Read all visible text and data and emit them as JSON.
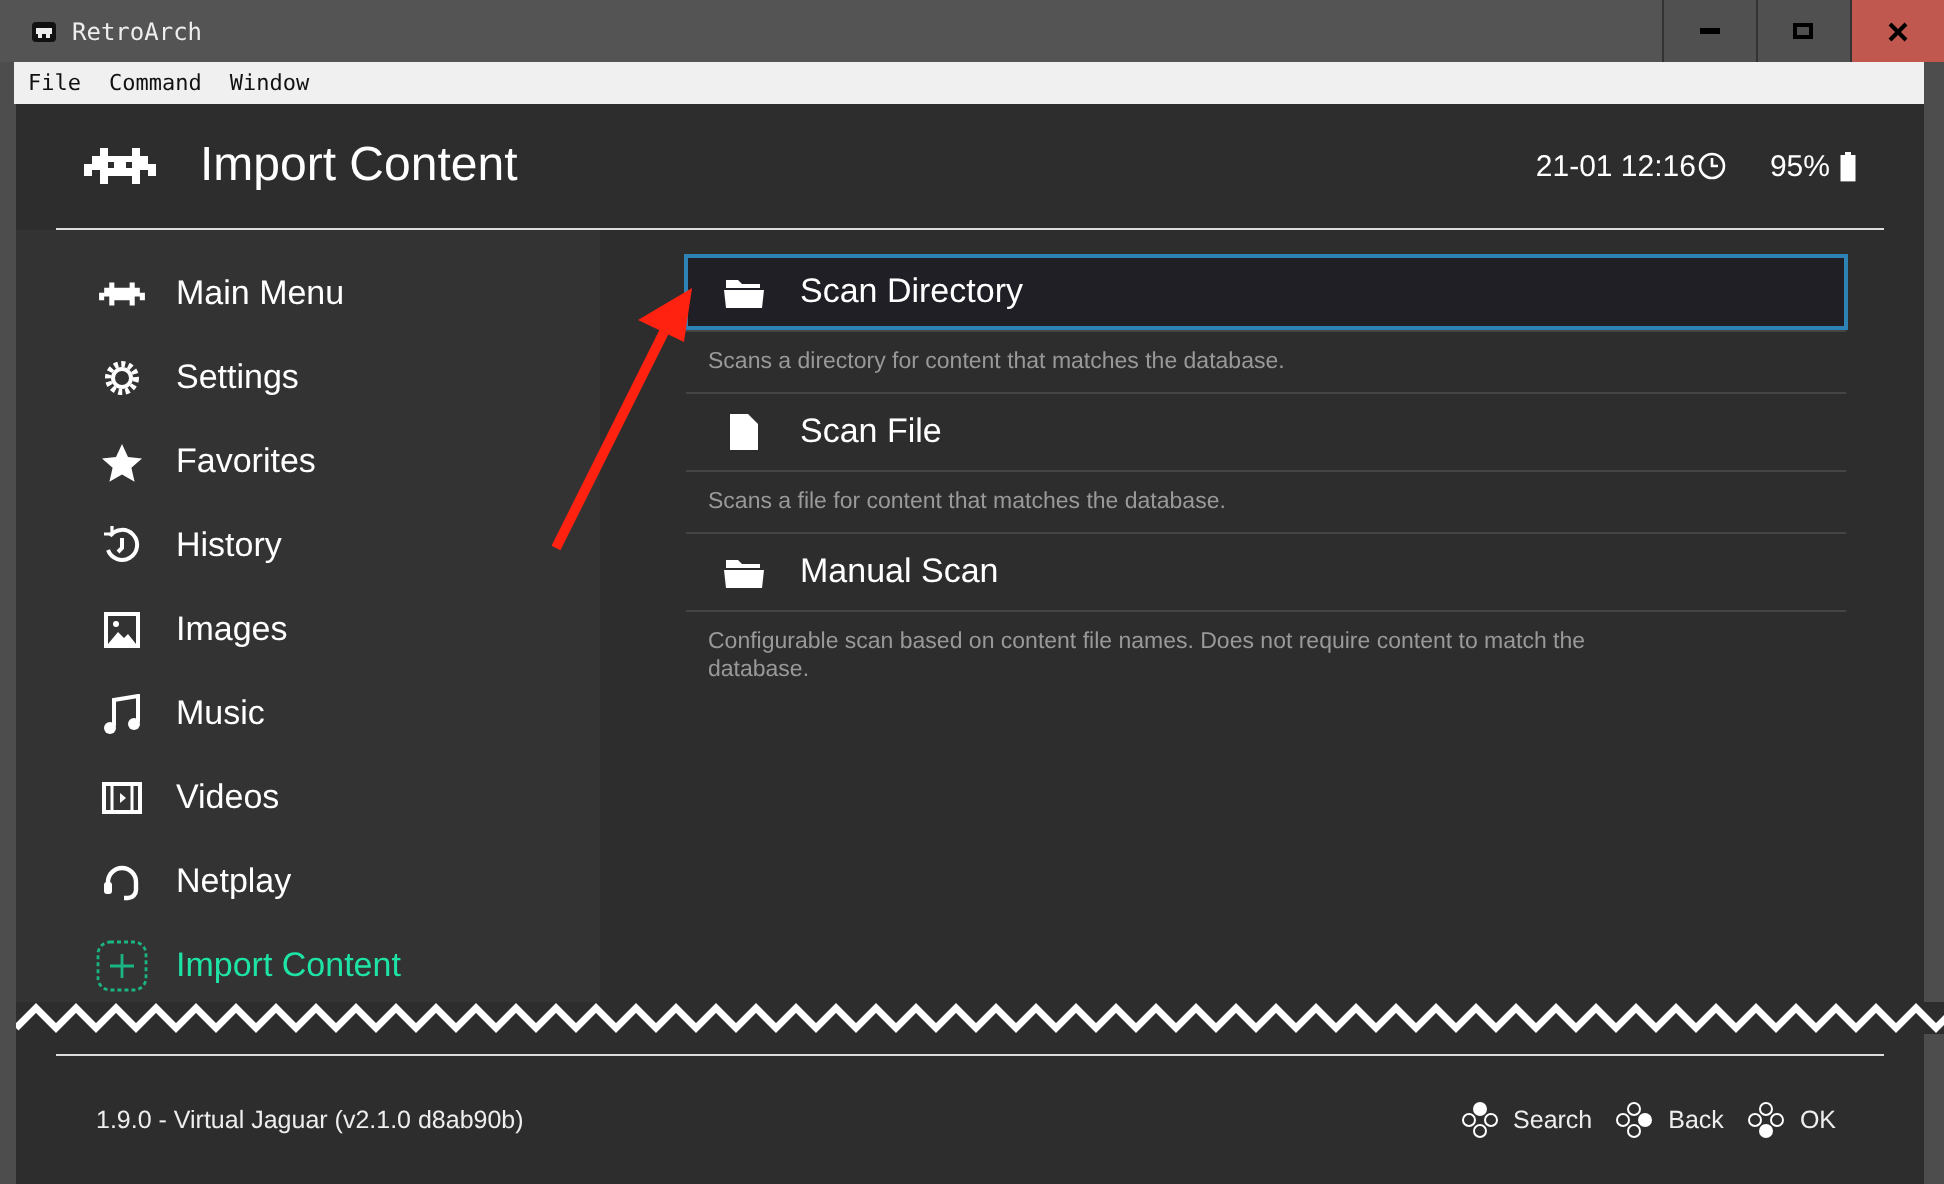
{
  "window": {
    "title": "RetroArch"
  },
  "menu": [
    "File",
    "Command",
    "Window"
  ],
  "header": {
    "title": "Import Content",
    "clock": "21-01 12:16",
    "battery": "95%"
  },
  "sidebar": {
    "items": [
      {
        "label": "Main Menu",
        "selected": false
      },
      {
        "label": "Settings",
        "selected": false
      },
      {
        "label": "Favorites",
        "selected": false
      },
      {
        "label": "History",
        "selected": false
      },
      {
        "label": "Images",
        "selected": false
      },
      {
        "label": "Music",
        "selected": false
      },
      {
        "label": "Videos",
        "selected": false
      },
      {
        "label": "Netplay",
        "selected": false
      },
      {
        "label": "Import Content",
        "selected": true
      }
    ]
  },
  "entries": [
    {
      "label": "Scan Directory",
      "selected": true,
      "description": "Scans a directory for content that matches the database."
    },
    {
      "label": "Scan File",
      "selected": false,
      "description": "Scans a file for content that matches the database."
    },
    {
      "label": "Manual Scan",
      "selected": false,
      "description": "Configurable scan based on content file names. Does not require content to match the database."
    }
  ],
  "footer": {
    "version": "1.9.0 - Virtual Jaguar (v2.1.0 d8ab90b)",
    "actions": [
      "Search",
      "Back",
      "OK"
    ]
  }
}
